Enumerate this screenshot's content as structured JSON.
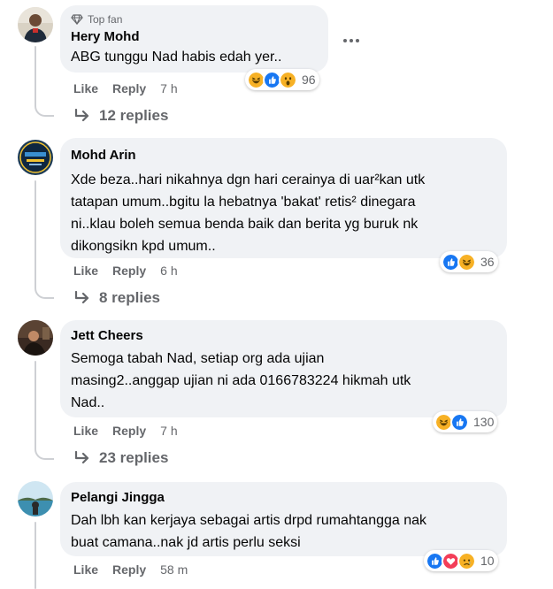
{
  "comments": [
    {
      "badge": "Top fan",
      "author": "Hery Mohd",
      "text": "ABG tunggu Nad habis edah yer..",
      "like": "Like",
      "reply": "Reply",
      "time": "7 h",
      "reactions": [
        "haha-icon",
        "like-icon",
        "wow-icon"
      ],
      "reaction_count": "96",
      "replies": "12 replies"
    },
    {
      "author": "Mohd Arin",
      "text": "Xde beza..hari nikahnya dgn hari cerainya di uar²kan utk tatapan umum..bgitu la hebatnya 'bakat' retis² dinegara ni..klau boleh semua benda baik dan berita yg buruk nk dikongsikn kpd umum..",
      "lines": [
        "Xde beza..hari nikahnya dgn hari cerainya di uar²kan utk",
        "tatapan umum..bgitu la hebatnya 'bakat' retis² dinegara",
        "ni..klau boleh semua benda baik dan berita yg buruk nk",
        "dikongsikn kpd umum.."
      ],
      "like": "Like",
      "reply": "Reply",
      "time": "6 h",
      "reactions": [
        "like-icon",
        "haha-icon"
      ],
      "reaction_count": "36",
      "replies": "8 replies"
    },
    {
      "author": "Jett Cheers",
      "lines": [
        "Semoga tabah Nad, setiap org ada ujian",
        "masing2..anggap ujian ni ada 0166783224 hikmah utk",
        "Nad.."
      ],
      "like": "Like",
      "reply": "Reply",
      "time": "7 h",
      "reactions": [
        "haha-icon",
        "like-icon"
      ],
      "reaction_count": "130",
      "replies": "23 replies"
    },
    {
      "author": "Pelangi Jingga",
      "lines": [
        "Dah lbh kan kerjaya sebagai artis drpd rumahtangga nak",
        "buat camana..nak jd artis perlu seksi"
      ],
      "like": "Like",
      "reply": "Reply",
      "time": "58 m",
      "reactions": [
        "like-icon",
        "love-icon",
        "sad-icon"
      ],
      "reaction_count": "10"
    }
  ],
  "colors": {
    "bubble": "#f0f2f5",
    "secondary_text": "#65676b",
    "like_blue": "#1877f2",
    "love_red": "#f33e58",
    "haha_yellow": "#f7b125"
  }
}
